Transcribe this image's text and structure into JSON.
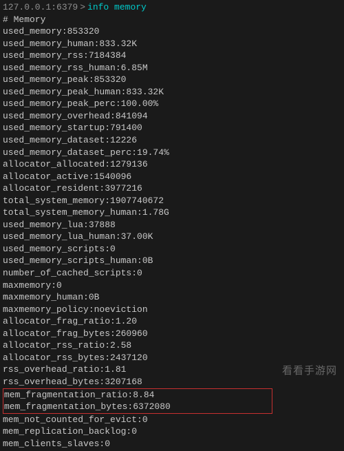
{
  "prompt": {
    "host": "127.0.0.1:6379",
    "arrow": ">",
    "command": "info memory"
  },
  "header": "# Memory",
  "lines": [
    "used_memory:853320",
    "used_memory_human:833.32K",
    "used_memory_rss:7184384",
    "used_memory_rss_human:6.85M",
    "used_memory_peak:853320",
    "used_memory_peak_human:833.32K",
    "used_memory_peak_perc:100.00%",
    "used_memory_overhead:841094",
    "used_memory_startup:791400",
    "used_memory_dataset:12226",
    "used_memory_dataset_perc:19.74%",
    "allocator_allocated:1279136",
    "allocator_active:1540096",
    "allocator_resident:3977216",
    "total_system_memory:1907740672",
    "total_system_memory_human:1.78G",
    "used_memory_lua:37888",
    "used_memory_lua_human:37.00K",
    "used_memory_scripts:0",
    "used_memory_scripts_human:0B",
    "number_of_cached_scripts:0",
    "maxmemory:0",
    "maxmemory_human:0B",
    "maxmemory_policy:noeviction",
    "allocator_frag_ratio:1.20",
    "allocator_frag_bytes:260960",
    "allocator_rss_ratio:2.58",
    "allocator_rss_bytes:2437120",
    "rss_overhead_ratio:1.81",
    "rss_overhead_bytes:3207168"
  ],
  "highlighted": [
    "mem_fragmentation_ratio:8.84",
    "mem_fragmentation_bytes:6372080"
  ],
  "trailing": [
    "mem_not_counted_for_evict:0",
    "mem_replication_backlog:0",
    "mem_clients_slaves:0"
  ],
  "watermark": "看看手游网"
}
